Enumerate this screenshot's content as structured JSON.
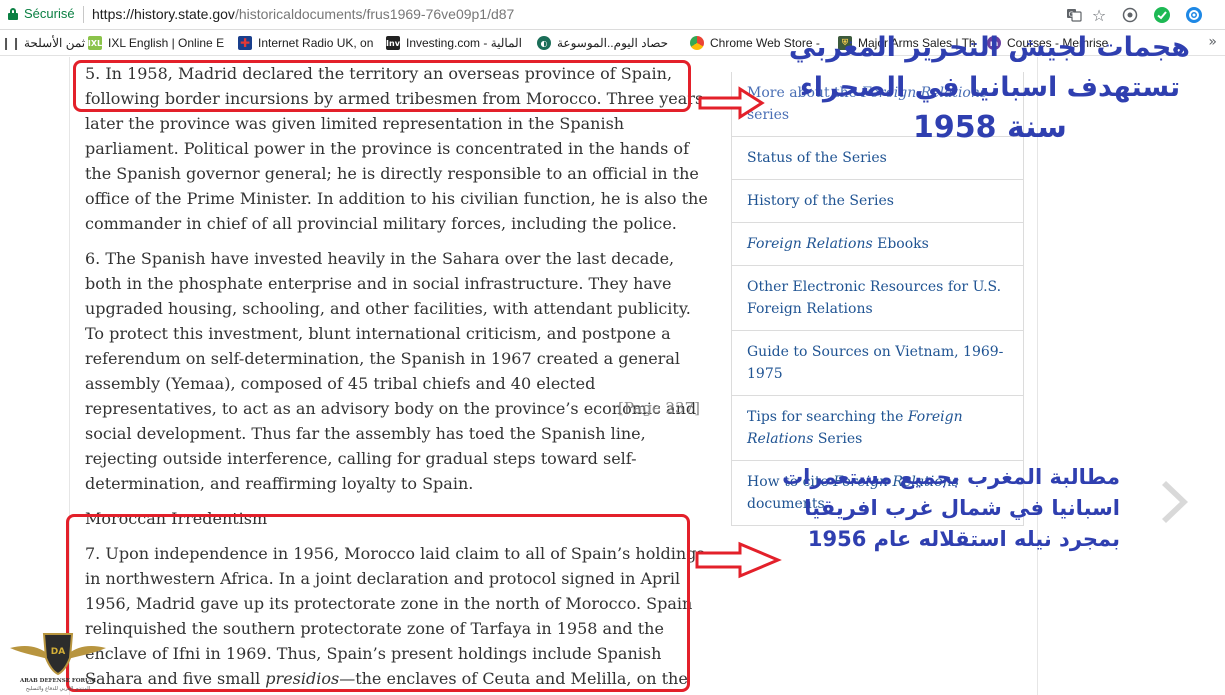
{
  "browser": {
    "secure_label": "Sécurisé",
    "url_scheme": "https://",
    "url_host": "history.state.gov",
    "url_path": "/historicaldocuments/frus1969-76ve09p1/d87",
    "bookmarks": [
      {
        "label": "ثمن الأسلحة",
        "icon": "bookmark-icon"
      },
      {
        "label": "IXL English | Online E",
        "icon": "ixl-icon"
      },
      {
        "label": "Internet Radio UK, on",
        "icon": "uk-flag-icon"
      },
      {
        "label": "Investing.com - المالية",
        "icon": "investing-icon"
      },
      {
        "label": "حصاد اليوم..الموسوعة",
        "icon": "hasad-icon"
      },
      {
        "label": "Chrome Web Store -",
        "icon": "chrome-store-icon"
      },
      {
        "label": "Major Arms Sales | Th",
        "icon": "shield-icon"
      },
      {
        "label": "Courses - Memrise",
        "icon": "memrise-icon"
      }
    ],
    "colors": {
      "secure": "#0b8043",
      "link": "#205493",
      "annotation_red": "#e3202a",
      "annotation_blue": "#2f3fb0"
    }
  },
  "document": {
    "paragraphs": {
      "p5": "5. In 1958, Madrid declared the territory an overseas province of Spain, following border incursions by armed tribesmen from Morocco. Three years later the province was given limited representation in the Spanish parliament. Political power in the province is concentrated in the hands of the Spanish governor general; he is directly responsible to an official in the office of the Prime Minister. In addition to his civilian function, he is also the commander in chief of all provincial military forces, including the police.",
      "p6": "6. The Spanish have invested heavily in the Sahara over the last decade, both in the phosphate enterprise and in social infrastructure. They have upgraded housing, schooling, and other facilities, with attendant publicity. To protect this investment, blunt international criticism, and postpone a referendum on self-determination, the Spanish in 1967 created a general assembly (Yemaa), composed of 45 tribal chiefs and 40 elected representatives, to act as an advisory body on the province’s economic and social development. Thus far the assembly has toed the Spanish line, rejecting outside interference, calling for gradual steps toward self-determination, and reaffirming loyalty to Spain.",
      "page_ref": "[Page 237]",
      "heading": "Moroccan Irredentism",
      "p7_before": "7. Upon independence in 1956, Morocco laid claim to all of Spain’s holdings in northwestern Africa. In a joint declaration and protocol signed in April 1956, Madrid gave up its protectorate zone in the north of Morocco. Spain relinquished the southern protectorate zone of Tarfaya in 1958 and the enclave of Ifni in 1969. Thus, Spain’s present holdings include Spanish Sahara and five small ",
      "p7_em": "presidios",
      "p7_after": "—the enclaves of Ceuta and Melilla, on the Mediterranean coast of Morocco, and three small offshore islands."
    }
  },
  "sidebar": {
    "items": [
      {
        "pre": "More about the ",
        "em": "Foreign Relations",
        "post": " series"
      },
      {
        "pre": "Status of the Series",
        "em": "",
        "post": ""
      },
      {
        "pre": "History of the Series",
        "em": "",
        "post": ""
      },
      {
        "pre": "",
        "em": "Foreign Relations",
        "post": " Ebooks"
      },
      {
        "pre": "Other Electronic Resources for U.S. Foreign Relations",
        "em": "",
        "post": ""
      },
      {
        "pre": "Guide to Sources on Vietnam, 1969-1975",
        "em": "",
        "post": ""
      },
      {
        "pre": "Tips for searching the ",
        "em": "Foreign Relations",
        "post": " Series"
      },
      {
        "pre": "How to cite ",
        "em": "Foreign Relations",
        "post": " documents"
      }
    ]
  },
  "annotations": {
    "note1": [
      "هجمات لجيش التحرير المغربي",
      "تستهدف اسبانيا في الصحراء",
      "سنة 1958"
    ],
    "note2": [
      "مطالبة المغرب بجميع مستعمرات",
      "اسبانيا في شمال غرب افريقيا",
      "بمجرد نيله استقلاله عام 1956"
    ]
  },
  "watermark": {
    "text": "ARAB DEFENSE FORUM",
    "sub": "المنتدى العربي للدفاع والتسليح",
    "mark": "DA"
  }
}
